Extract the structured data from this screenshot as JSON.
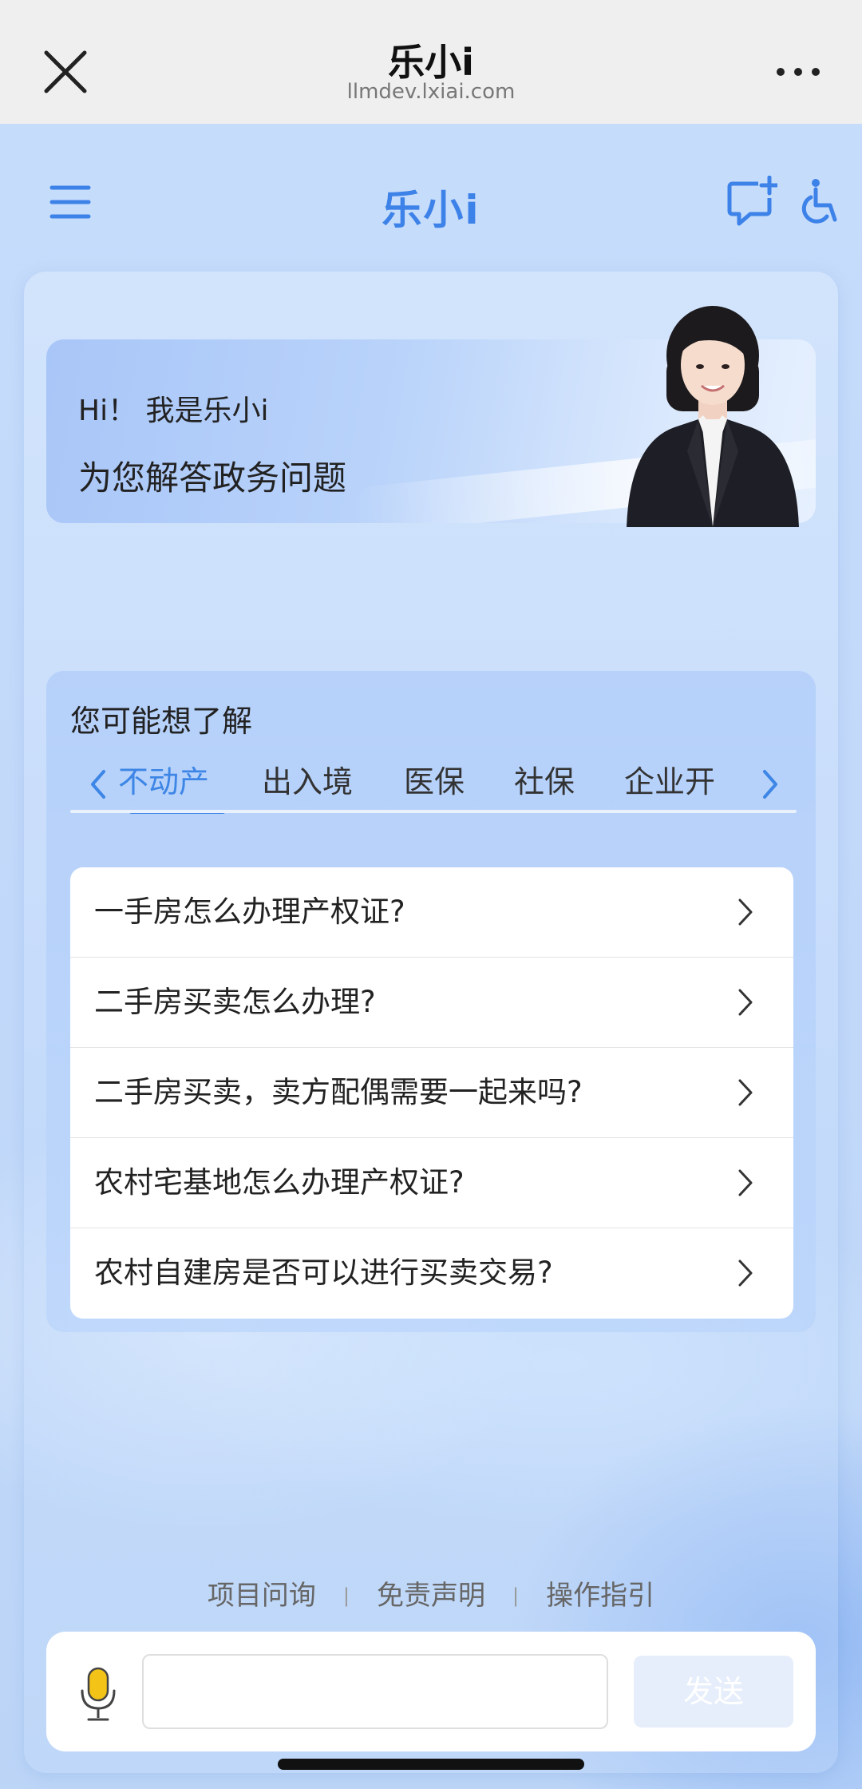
{
  "browser": {
    "title": "乐小i",
    "url": "llmdev.lxiai.com"
  },
  "app": {
    "title": "乐小i",
    "accent_color": "#3d82e8"
  },
  "banner": {
    "greeting": "Hi！ 我是乐小i",
    "subtitle": "为您解答政务问题"
  },
  "suggest": {
    "heading": "您可能想了解",
    "tabs": [
      {
        "label": "不动产",
        "active": true
      },
      {
        "label": "出入境",
        "active": false
      },
      {
        "label": "医保",
        "active": false
      },
      {
        "label": "社保",
        "active": false
      },
      {
        "label": "企业开",
        "active": false
      }
    ],
    "questions": [
      "一手房怎么办理产权证?",
      "二手房买卖怎么办理?",
      "二手房买卖，卖方配偶需要一起来吗?",
      "农村宅基地怎么办理产权证?",
      "农村自建房是否可以进行买卖交易?"
    ]
  },
  "footer": {
    "links": [
      "项目问询",
      "免责声明",
      "操作指引"
    ],
    "separator": "|"
  },
  "input": {
    "value": "",
    "send_label": "发送"
  }
}
